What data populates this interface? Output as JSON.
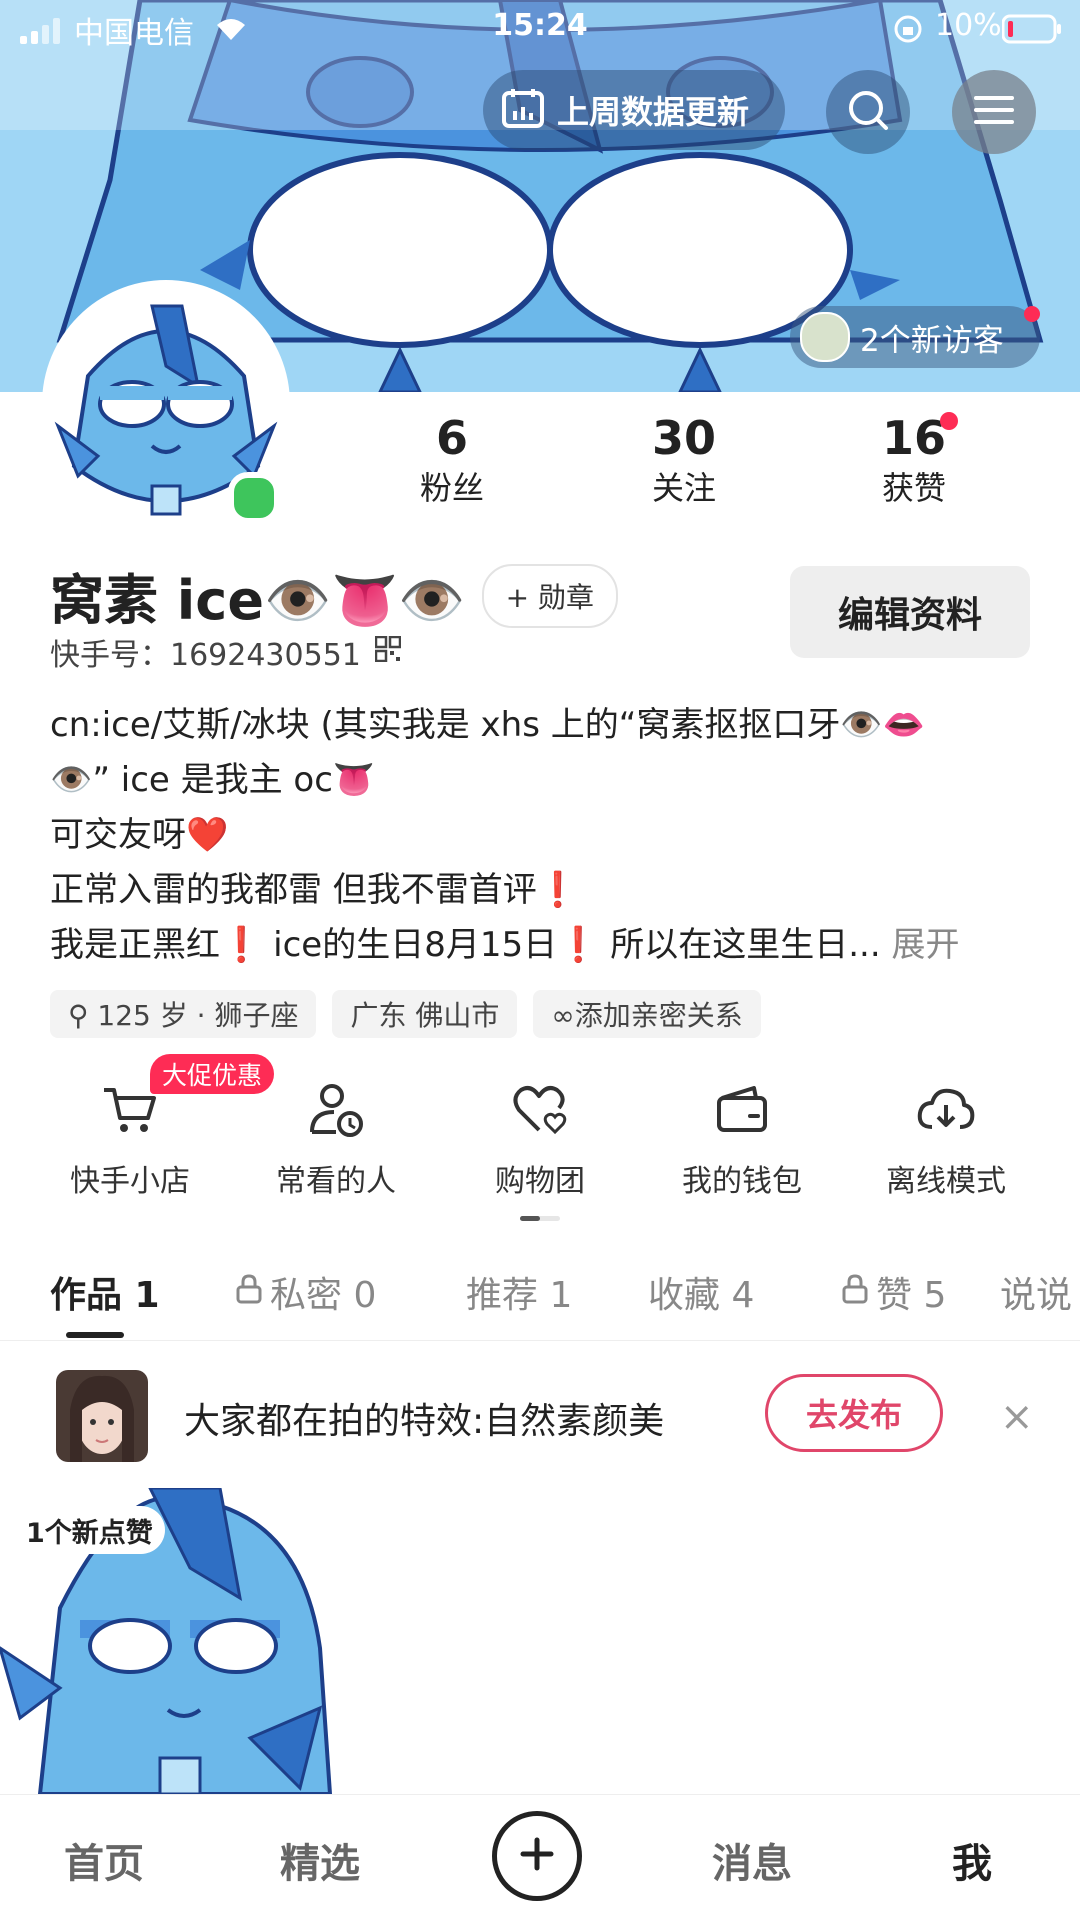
{
  "status_bar": {
    "carrier": "中国电信",
    "time": "15:24",
    "battery": "10%"
  },
  "header": {
    "weekly_update": "上周数据更新",
    "visitors": "2个新访客"
  },
  "stats": [
    {
      "num": "6",
      "label": "粉丝"
    },
    {
      "num": "30",
      "label": "关注"
    },
    {
      "num": "16",
      "label": "获赞"
    }
  ],
  "profile": {
    "name": "窝素 ice👁️👅👁️",
    "badge": "+ 勋章",
    "kwai_id": "快手号：1692430551",
    "edit": "编辑资料",
    "bio": [
      "cn:ice/艾斯/冰块 (其实我是 xhs 上的“窝素抠抠口牙👁️👄",
      "👁️” ice 是我主 oc👅",
      "可交友呀❤️",
      "正常入雷的我都雷 但我不雷首评❗",
      "我是正黑红❗ ice的生日8月15日❗ 所以在这里生日... "
    ],
    "bio_expand": "展开",
    "tags": [
      "⚲ 125 岁 · 狮子座",
      "广东 佛山市",
      "∞添加亲密关系"
    ]
  },
  "shortcuts": [
    {
      "label": "快手小店",
      "icon": "cart-icon"
    },
    {
      "label": "常看的人",
      "icon": "person-clock-icon"
    },
    {
      "label": "购物团",
      "icon": "heart-group-icon"
    },
    {
      "label": "我的钱包",
      "icon": "wallet-icon"
    },
    {
      "label": "离线模式",
      "icon": "download-cloud-icon"
    }
  ],
  "promo_badge": "大促优惠",
  "tabs": [
    {
      "label": "作品 1",
      "locked": false
    },
    {
      "label": "私密 0",
      "locked": true
    },
    {
      "label": "推荐 1",
      "locked": false
    },
    {
      "label": "收藏 4",
      "locked": false
    },
    {
      "label": "赞 5",
      "locked": true
    },
    {
      "label": "说说",
      "locked": false
    }
  ],
  "effect_banner": {
    "text": "大家都在拍的特效:自然素颜美",
    "button": "去发布",
    "close": "×"
  },
  "video": {
    "badge": "1个新点赞"
  },
  "bottom_nav": {
    "home": "首页",
    "featured": "精选",
    "messages": "消息",
    "me": "我"
  },
  "colors": {
    "accent": "#fe2c55",
    "publish": "#e0466a",
    "banner": "#8ed0f4",
    "online": "#3ec55c"
  }
}
